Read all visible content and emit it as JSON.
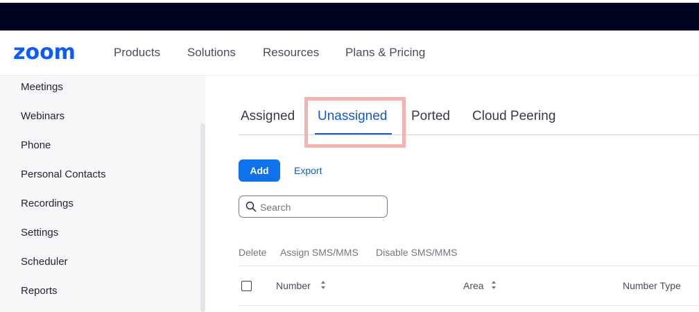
{
  "brand": {
    "logo_text": "zoom",
    "color": "#0b5cff"
  },
  "nav": [
    "Products",
    "Solutions",
    "Resources",
    "Plans & Pricing"
  ],
  "sidebar": {
    "items": [
      "Meetings",
      "Webinars",
      "Phone",
      "Personal Contacts",
      "Recordings",
      "Settings",
      "Scheduler",
      "Reports"
    ]
  },
  "tabs": {
    "items": [
      "Assigned",
      "Unassigned",
      "Ported",
      "Cloud Peering"
    ],
    "active": "Unassigned",
    "active_color": "#0e5ad1",
    "highlight_color": "#f2b3b3"
  },
  "toolbar": {
    "add_label": "Add",
    "export_label": "Export",
    "add_color": "#0e72ed"
  },
  "search": {
    "placeholder": "Search",
    "value": "",
    "icon": "search-icon"
  },
  "bulk_actions": [
    "Delete",
    "Assign SMS/MMS",
    "Disable SMS/MMS"
  ],
  "table": {
    "columns": [
      {
        "label": "Number",
        "sortable": true
      },
      {
        "label": "Area",
        "sortable": true
      },
      {
        "label": "Number Type",
        "sortable": false
      }
    ]
  }
}
